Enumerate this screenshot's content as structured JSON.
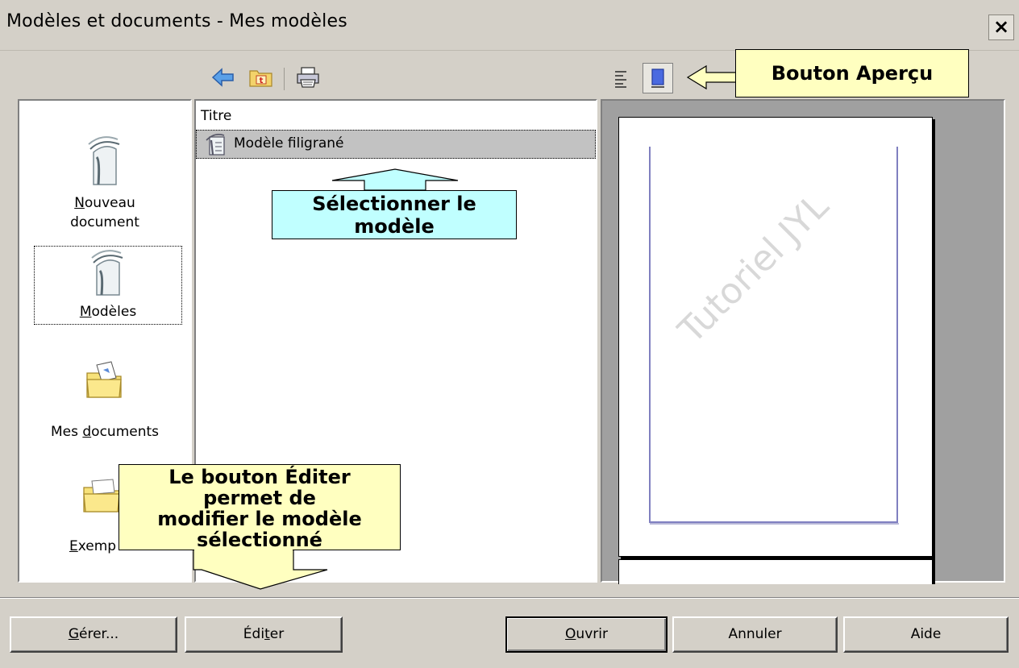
{
  "window": {
    "title": "Modèles et documents - Mes modèles",
    "close_label": "×"
  },
  "toolbar": {
    "back_icon": "back-arrow-icon",
    "folder_up_icon": "folder-up-icon",
    "print_icon": "printer-icon",
    "list_view_icon": "document-properties-icon",
    "preview_icon": "preview-icon"
  },
  "sidebar": {
    "items": [
      {
        "pre": "",
        "ul": "N",
        "post": "ouveau",
        "line2": "document",
        "icon": "new-document-icon"
      },
      {
        "pre": "",
        "ul": "M",
        "post": "odèles",
        "line2": "",
        "icon": "templates-icon"
      },
      {
        "pre": "Mes ",
        "ul": "d",
        "post": "ocuments",
        "line2": "",
        "icon": "my-documents-folder-icon"
      },
      {
        "pre": "",
        "ul": "E",
        "post": "xemp",
        "line2": "",
        "icon": "samples-folder-icon"
      }
    ]
  },
  "file_list": {
    "column_header": "Titre",
    "rows": [
      {
        "label": "Modèle filigrané",
        "icon": "template-file-icon"
      }
    ]
  },
  "preview": {
    "watermark": "Tutoriel JYL"
  },
  "callouts": {
    "apercu": "Bouton Aperçu",
    "select_line1": "Sélectionner le",
    "select_line2": "modèle",
    "edit_line1": "Le bouton Éditer",
    "edit_line2": "permet de",
    "edit_line3": "modifier le modèle",
    "edit_line4": "sélectionné"
  },
  "buttons": {
    "gerer": {
      "pre": "",
      "ul": "G",
      "post": "érer..."
    },
    "editer": {
      "pre": "Édi",
      "ul": "t",
      "post": "er"
    },
    "ouvrir": {
      "pre": "",
      "ul": "O",
      "post": "uvrir"
    },
    "annuler": {
      "pre": "Annuler",
      "ul": "",
      "post": ""
    },
    "aide": {
      "pre": "Aide",
      "ul": "",
      "post": ""
    }
  },
  "colors": {
    "dialog_bg": "#d4d0c8",
    "callout_yellow": "#ffffc0",
    "callout_cyan": "#c0ffff",
    "selection_gray": "#c2c2c2",
    "page_border_blue": "#8080c0"
  }
}
